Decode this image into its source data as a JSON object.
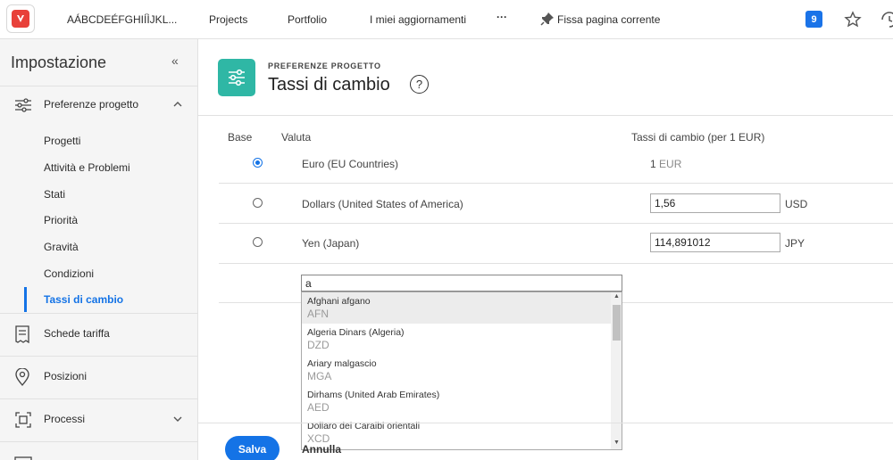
{
  "topbar": {
    "app_name": "AÁBCDEÉFGHIÍÌJKL...",
    "links": [
      "Projects",
      "Portfolio",
      "I miei aggiornamenti"
    ],
    "more": "···",
    "pin_label": "Fissa pagina corrente",
    "notifications_count": "9"
  },
  "sidebar": {
    "title": "Impostazione",
    "collapse_symbol": "«",
    "sections": [
      {
        "label": "Preferenze progetto",
        "icon": "sliders-icon",
        "expanded": true
      },
      {
        "label": "Schede tariffa",
        "icon": "receipt-icon"
      },
      {
        "label": "Posizioni",
        "icon": "location-pin-icon"
      },
      {
        "label": "Processi",
        "icon": "process-icon",
        "expanded": false
      }
    ],
    "subitems": [
      "Progetti",
      "Attività e Problemi",
      "Stati",
      "Priorità",
      "Gravità",
      "Condizioni",
      "Tassi di cambio"
    ],
    "active_subitem": "Tassi di cambio"
  },
  "header": {
    "supertitle": "PREFERENZE PROGETTO",
    "title": "Tassi di cambio",
    "help": "?"
  },
  "table": {
    "columns": {
      "base": "Base",
      "currency": "Valuta",
      "rate": "Tassi di cambio (per 1 EUR)"
    },
    "rows": [
      {
        "name": "Euro (EU Countries)",
        "rate": "1",
        "unit": "EUR",
        "base": true
      },
      {
        "name": "Dollars (United States of America)",
        "rate": "1,56",
        "unit": "USD",
        "base": false
      },
      {
        "name": "Yen (Japan)",
        "rate": "114,891012",
        "unit": "JPY",
        "base": false
      }
    ]
  },
  "search": {
    "value": "a",
    "options": [
      {
        "name": "Afghani afgano",
        "code": "AFN"
      },
      {
        "name": "Algeria Dinars (Algeria)",
        "code": "DZD"
      },
      {
        "name": "Ariary malgascio",
        "code": "MGA"
      },
      {
        "name": "Dirhams (United Arab Emirates)",
        "code": "AED"
      },
      {
        "name": "Dollaro dei Caraibi orientali",
        "code": "XCD"
      }
    ]
  },
  "footer": {
    "save": "Salva",
    "cancel": "Annulla"
  },
  "colors": {
    "accent": "#1473e6",
    "header_icon_bg": "#2fb7a5",
    "logo_red": "#e8413a"
  }
}
